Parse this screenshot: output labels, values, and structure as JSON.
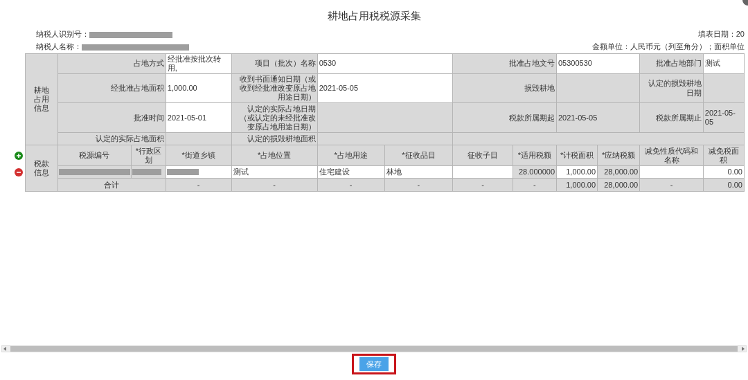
{
  "dialog": {
    "title": "耕地占用税税源采集"
  },
  "taxpayer_id": {
    "label": "纳税人识别号：",
    "redacted": true
  },
  "taxpayer_name": {
    "label": "纳税人名称：",
    "redacted": true
  },
  "fill_date": "填表日期：20",
  "units": "金额单位：人民币元（列至角分）；面积单位",
  "occupation_section": {
    "label": "耕地占用信息",
    "rows": [
      [
        {
          "kind": "label",
          "text": "占地方式"
        },
        {
          "kind": "value",
          "text": "经批准按批次转用,",
          "editable": true
        },
        {
          "kind": "label",
          "text": "项目（批次）名称"
        },
        {
          "kind": "value",
          "text": "0530",
          "editable": true
        },
        {
          "kind": "label",
          "text": "批准占地文号"
        },
        {
          "kind": "value",
          "text": "05300530",
          "editable": true
        },
        {
          "kind": "label",
          "text": "批准占地部门"
        },
        {
          "kind": "value",
          "text": "测试",
          "editable": true
        }
      ],
      [
        {
          "kind": "label",
          "text": "经批准占地面积"
        },
        {
          "kind": "value",
          "text": "1,000.00",
          "editable": true
        },
        {
          "kind": "label",
          "text": "收到书面通知日期（或收到经批准改变原占地用途日期）"
        },
        {
          "kind": "value",
          "text": "2021-05-05",
          "editable": true
        },
        {
          "kind": "label",
          "text": "损毁耕地"
        },
        {
          "kind": "value",
          "editable": false
        },
        {
          "kind": "label",
          "text": "认定的损毁耕地日期"
        },
        {
          "kind": "value",
          "editable": false
        }
      ],
      [
        {
          "kind": "label",
          "text": "批准时间"
        },
        {
          "kind": "value",
          "text": "2021-05-01",
          "editable": true
        },
        {
          "kind": "label",
          "text": "认定的实际占地日期（或认定的未经批准改变原占地用途日期）"
        },
        {
          "kind": "value",
          "editable": false
        },
        {
          "kind": "label",
          "text": "税款所属期起"
        },
        {
          "kind": "value",
          "text": "2021-05-05",
          "editable": false
        },
        {
          "kind": "label",
          "text": "税款所属期止"
        },
        {
          "kind": "value",
          "text": "2021-05-05",
          "editable": false
        }
      ],
      [
        {
          "kind": "label",
          "text": "认定的实际占地面积"
        },
        {
          "kind": "value",
          "editable": false
        },
        {
          "kind": "label",
          "text": "认定的损毁耕地面积"
        },
        {
          "kind": "value",
          "editable": false
        }
      ]
    ]
  },
  "tax_section": {
    "label": "税款信息",
    "columns": [
      "税源编号",
      "*行政区划",
      "*街道乡镇",
      "*占地位置",
      "*占地用途",
      "*征收品目",
      "征收子目",
      "*适用税额",
      "*计税面积",
      "*应纳税额",
      "减免性质代码和名称",
      "减免税面积"
    ],
    "rows": [
      [
        {
          "kind": "text",
          "redacted": true,
          "editable": false
        },
        {
          "kind": "text",
          "redacted": true,
          "editable": false
        },
        {
          "kind": "text",
          "redacted": true,
          "editable": true
        },
        {
          "kind": "text",
          "text": "测试",
          "editable": true
        },
        {
          "kind": "text",
          "text": "住宅建设",
          "editable": true
        },
        {
          "kind": "text",
          "text": "林地",
          "editable": true
        },
        {
          "kind": "text",
          "editable": true
        },
        {
          "kind": "number",
          "text": "28.000000",
          "editable": false
        },
        {
          "kind": "number",
          "text": "1,000.00",
          "editable": true
        },
        {
          "kind": "number",
          "text": "28,000.00",
          "editable": false
        },
        {
          "kind": "text",
          "editable": true
        },
        {
          "kind": "number",
          "text": "0.00",
          "editable": true
        }
      ]
    ],
    "total": [
      {
        "kind": "center",
        "text": "合计"
      },
      {
        "kind": "center",
        "text": "-"
      },
      {
        "kind": "center",
        "text": "-"
      },
      {
        "kind": "center",
        "text": "-"
      },
      {
        "kind": "center",
        "text": "-"
      },
      {
        "kind": "center",
        "text": "-"
      },
      {
        "kind": "center",
        "text": "-"
      },
      {
        "kind": "number",
        "text": "1,000.00"
      },
      {
        "kind": "number",
        "text": "28,000.00"
      },
      {
        "kind": "center",
        "text": "-"
      },
      {
        "kind": "number",
        "text": "0.00"
      }
    ]
  },
  "save_button": {
    "label": "保存",
    "highlighted": true
  }
}
